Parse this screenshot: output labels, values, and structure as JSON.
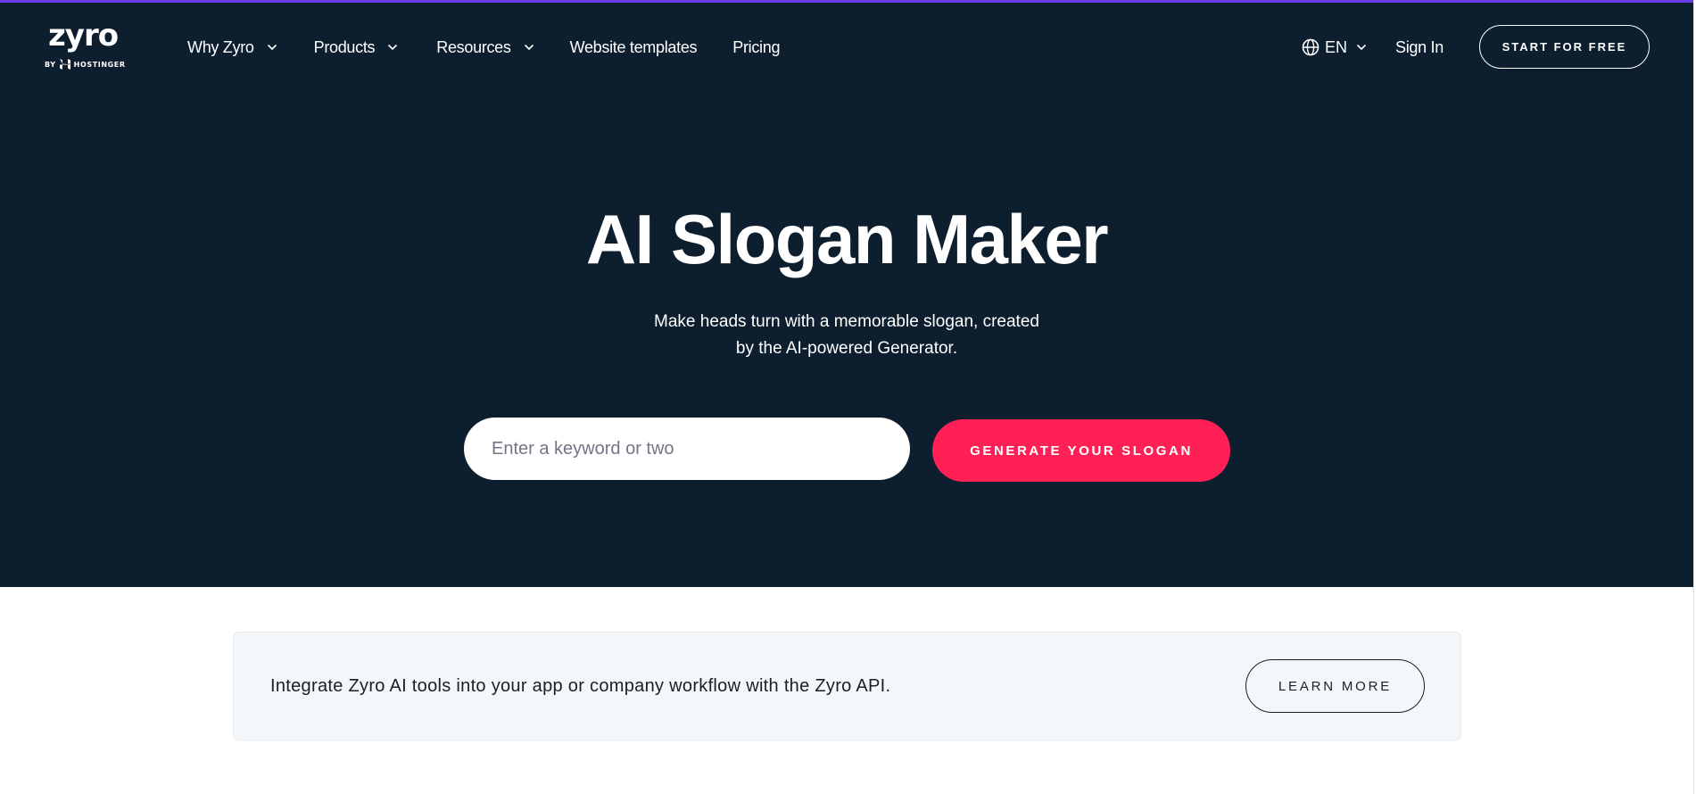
{
  "brand": {
    "logo_word": "zyro",
    "logo_by": "BY",
    "logo_parent": "HOSTINGER",
    "accent_color": "#673de6",
    "hero_bg": "#0d1e2f",
    "cta_color": "#ff2156"
  },
  "nav": {
    "items": [
      {
        "label": "Why Zyro",
        "has_dropdown": true,
        "icon": "chevron-down-icon"
      },
      {
        "label": "Products",
        "has_dropdown": true,
        "icon": "chevron-down-icon"
      },
      {
        "label": "Resources",
        "has_dropdown": true,
        "icon": "chevron-down-icon"
      },
      {
        "label": "Website templates",
        "has_dropdown": false
      },
      {
        "label": "Pricing",
        "has_dropdown": false
      }
    ],
    "language": {
      "label": "EN",
      "icon": "globe-icon"
    },
    "sign_in": "Sign In",
    "start_button": "START FOR FREE"
  },
  "hero": {
    "title": "AI Slogan Maker",
    "subtitle_line1": "Make heads turn with a memorable slogan, created",
    "subtitle_line2": "by the AI-powered Generator.",
    "input_placeholder": "Enter a keyword or two",
    "input_value": "",
    "generate_button": "GENERATE YOUR SLOGAN"
  },
  "api_banner": {
    "text": "Integrate Zyro AI tools into your app or company workflow with the Zyro API.",
    "button": "LEARN MORE"
  }
}
